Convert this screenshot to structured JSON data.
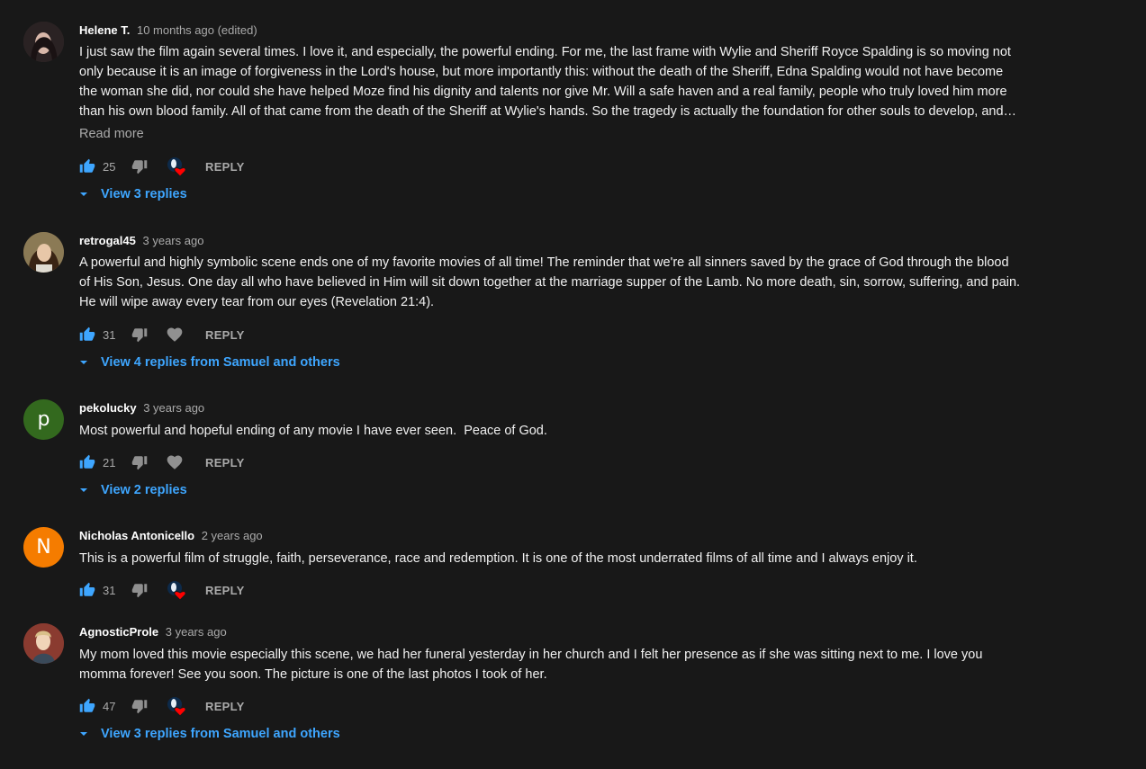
{
  "comments": [
    {
      "author": "Helene T.",
      "time": "10 months ago (edited)",
      "lines": [
        "I just saw the film again several times. I love it, and especially, the powerful ending. For me, the last frame with Wylie and Sheriff Royce Spalding is so moving not",
        "only because it is an image of forgiveness in the Lord's house, but more importantly this: without the death of the Sheriff, Edna Spalding would not have become",
        "the woman she did, nor could she have helped Moze find his dignity and talents nor give Mr. Will a safe haven and a real family, people who truly loved him more",
        "than his own blood family. All of that came from the death of the Sheriff at Wylie's hands. So the tragedy is actually the foundation for other souls to develop, and…"
      ],
      "read_more": "Read more",
      "likes": "25",
      "reply_label": "REPLY",
      "replies_label": "View 3 replies",
      "hearted": true
    },
    {
      "author": "retrogal45",
      "time": "3 years ago",
      "lines": [
        "A powerful and highly symbolic scene ends one of my favorite movies of all time! The reminder that we're all sinners saved by the grace of God through the blood",
        "of His Son, Jesus. One day all who have believed in Him will sit down together at the marriage supper of the Lamb. No more death, sin, sorrow, suffering, and pain.",
        "He will wipe away every tear from our eyes (Revelation 21:4)."
      ],
      "likes": "31",
      "reply_label": "REPLY",
      "replies_label": "View 4 replies from Samuel and others",
      "hearted": false
    },
    {
      "author": "pekolucky",
      "time": "3 years ago",
      "avatar_letter": "p",
      "avatar_color": "#33691e",
      "lines": [
        "Most powerful and hopeful ending of any movie I have ever seen.  Peace of God."
      ],
      "likes": "21",
      "reply_label": "REPLY",
      "replies_label": "View 2 replies",
      "hearted": false
    },
    {
      "author": "Nicholas Antonicello",
      "time": "2 years ago",
      "avatar_letter": "N",
      "avatar_color": "#f57c00",
      "lines": [
        "This is a powerful film of struggle, faith, perseverance, race and redemption. It is one of the most underrated films of all time and I always enjoy it."
      ],
      "likes": "31",
      "reply_label": "REPLY",
      "hearted": true
    },
    {
      "author": "AgnosticProle",
      "time": "3 years ago",
      "lines": [
        "My mom loved this movie especially this scene, we had her funeral yesterday in her church and I felt her presence as if she was sitting next to me. I love you",
        "momma forever! See you soon. The picture is one of the last photos I took of her."
      ],
      "likes": "47",
      "reply_label": "REPLY",
      "replies_label": "View 3 replies from Samuel and others",
      "hearted": true
    }
  ],
  "colors": {
    "background": "#181818",
    "link": "#3ea6ff",
    "secondary_text": "#aaaaaa",
    "heart": "#ff0000"
  },
  "icons": {
    "like": "thumb-up-icon",
    "dislike": "thumb-down-icon",
    "heart": "heart-icon",
    "expand": "caret-down-icon"
  }
}
